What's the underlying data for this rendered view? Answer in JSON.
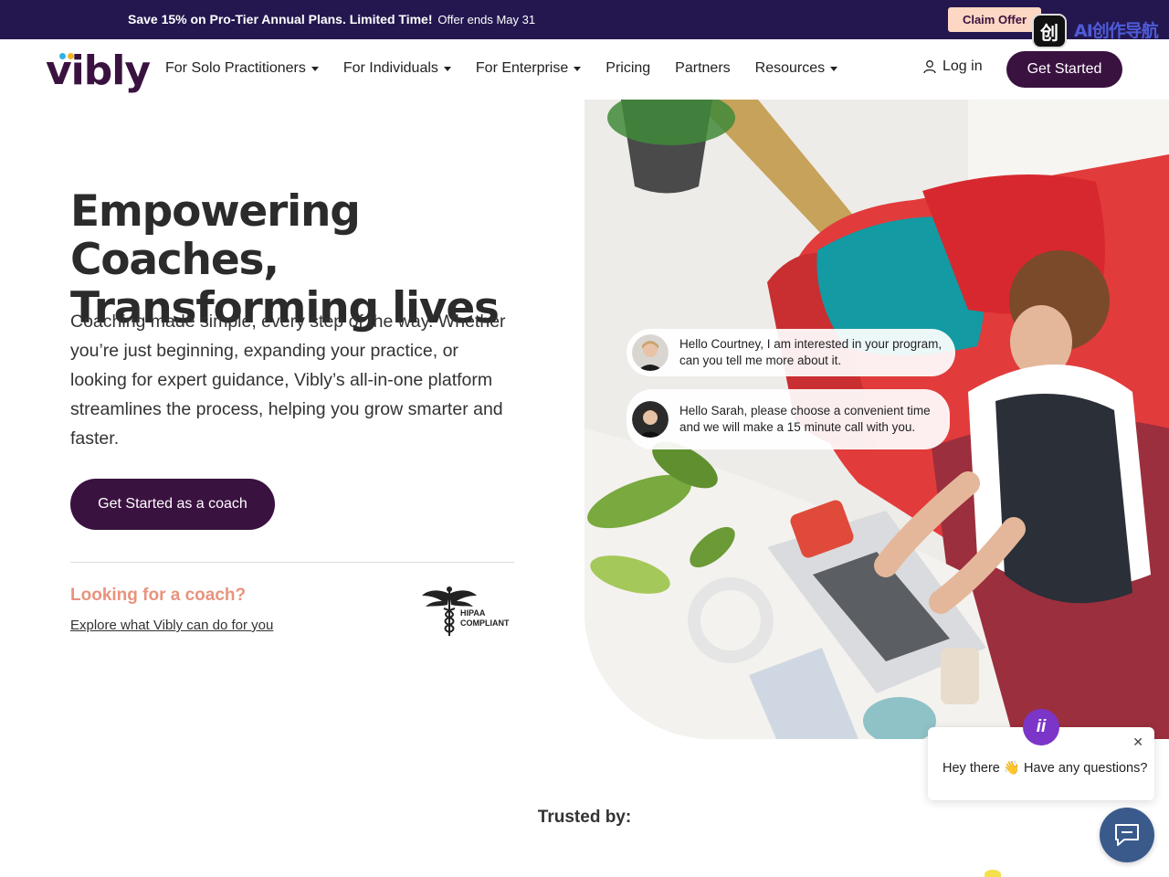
{
  "promo": {
    "headline": "Save 15% on Pro-Tier Annual Plans. Limited Time!",
    "subtext": "Offer ends May 31",
    "cta": "Claim Offer"
  },
  "ai_badge": {
    "logo_glyph": "创",
    "title": "AI创作导航"
  },
  "brand": {
    "name": "vibly",
    "dot_colors": [
      "#2fb3e3",
      "#f0b429"
    ]
  },
  "nav": {
    "items": [
      {
        "label": "For Solo Practitioners",
        "has_dropdown": true
      },
      {
        "label": "For Individuals",
        "has_dropdown": true
      },
      {
        "label": "For Enterprise",
        "has_dropdown": true
      },
      {
        "label": "Pricing",
        "has_dropdown": false
      },
      {
        "label": "Partners",
        "has_dropdown": false
      },
      {
        "label": "Resources",
        "has_dropdown": true
      }
    ],
    "login": "Log in",
    "cta": "Get Started"
  },
  "hero": {
    "title_line1": "Empowering Coaches,",
    "title_line2": "Transforming lives",
    "description": "Coaching made simple, every step of the way. Whether you’re just beginning, expanding your practice, or looking for expert guidance, Vibly’s all-in-one platform streamlines the process, helping you grow smarter and faster.",
    "cta": "Get Started as a coach",
    "coach_question": "Looking for a coach?",
    "coach_link": "Explore what Vibly can do for you",
    "hipaa_line1": "HIPAA",
    "hipaa_line2": "COMPLIANT"
  },
  "chat_bubbles": [
    {
      "text": "Hello Courtney, I am interested in your program, can you tell me more about it."
    },
    {
      "text": "Hello Sarah, please choose a convenient time and we will make a 15 minute call with you."
    }
  ],
  "trusted": {
    "label": "Trusted by:"
  },
  "chat_widget": {
    "avatar_text": "ii",
    "message": "Hey there 👋 Have any questions?",
    "close_glyph": "✕"
  },
  "colors": {
    "brand_purple": "#3a1240",
    "promo_bg": "#24174f",
    "claim_bg": "#fdd7c3",
    "accent_coral": "#e8937d",
    "chat_purple": "#7b35c8",
    "launcher_blue": "#3a5a8c"
  }
}
